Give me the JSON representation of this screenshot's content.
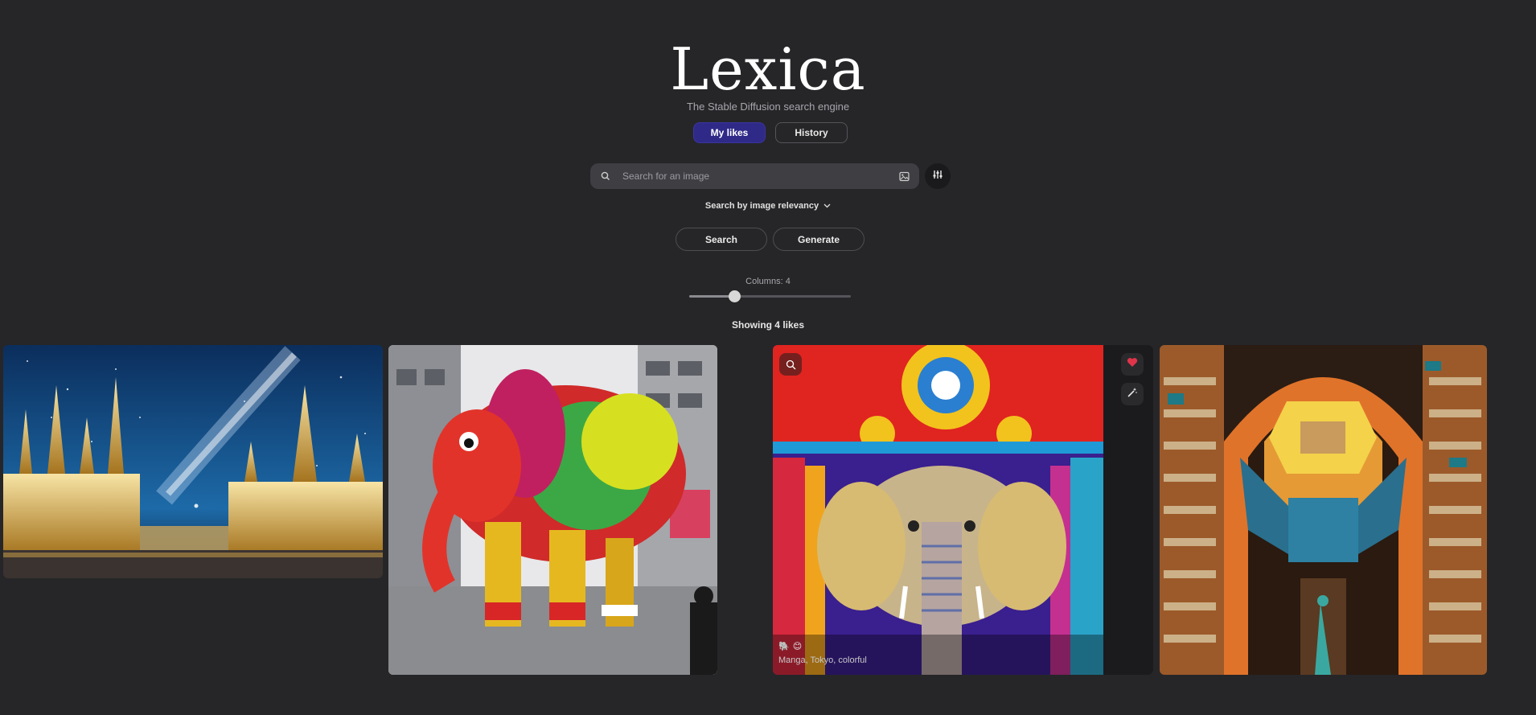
{
  "brand": {
    "logo": "Lexica",
    "tagline": "The Stable Diffusion search engine"
  },
  "tabs": [
    {
      "label": "My likes",
      "active": true
    },
    {
      "label": "History",
      "active": false
    }
  ],
  "search": {
    "placeholder": "Search for an image",
    "mode_label": "Search by image relevancy"
  },
  "actions": {
    "search_label": "Search",
    "generate_label": "Generate"
  },
  "columns": {
    "label": "Columns: 4",
    "value": 4,
    "min": 1,
    "max": 10
  },
  "results": {
    "showing": "Showing 4 likes",
    "images": [
      {
        "subject": "cathedral-night-sky"
      },
      {
        "subject": "patterned-elephant-street"
      },
      {
        "subject": "stained-glass-elephant",
        "caption": "Manga, Tokyo, colorful",
        "liked": true
      },
      {
        "subject": "library-archway"
      }
    ]
  },
  "colors": {
    "background": "#262628",
    "accent": "#2f2a88",
    "heart": "#e0344a"
  },
  "icons": [
    "search-icon",
    "image-upload-icon",
    "sliders-icon",
    "chevron-down-icon",
    "heart-icon",
    "magic-wand-icon",
    "zoom-icon"
  ]
}
